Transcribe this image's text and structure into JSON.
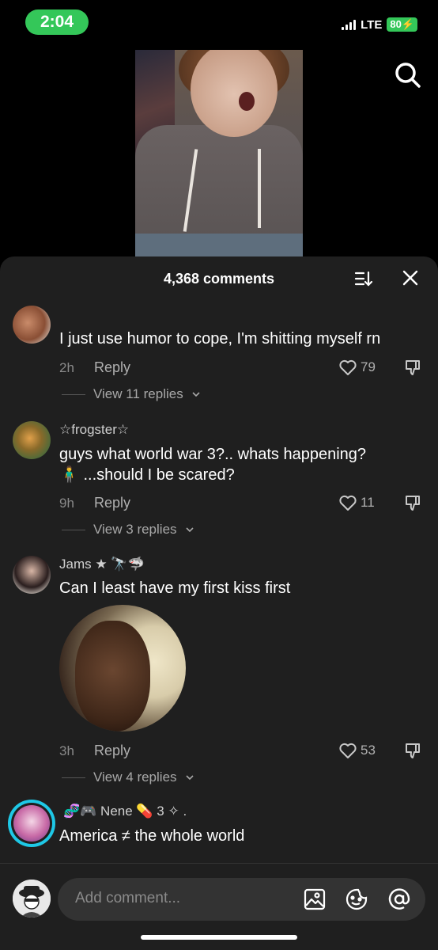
{
  "status": {
    "time": "2:04",
    "network": "LTE",
    "battery": "80"
  },
  "comments_header": {
    "count_label": "4,368 comments"
  },
  "comments": [
    {
      "username": "",
      "text": "I just use humor to cope, I'm shitting myself rn",
      "time": "2h",
      "reply_label": "Reply",
      "likes": "79",
      "view_replies": "View 11 replies"
    },
    {
      "username": "☆frogster☆",
      "text_line1": "guys what world war 3?.. whats happening?",
      "text_line2": "🧍‍♂️ ...should I be scared?",
      "time": "9h",
      "reply_label": "Reply",
      "likes": "11",
      "view_replies": "View 3 replies"
    },
    {
      "username": "Jams ★ 🔭🦈",
      "text": "Can I least have my first kiss first",
      "time": "3h",
      "reply_label": "Reply",
      "likes": "53",
      "view_replies": "View 4 replies"
    },
    {
      "username": "🧬🎮 Nene 💊 3 ✧ .",
      "text": "America ≠ the whole world"
    }
  ],
  "input": {
    "placeholder": "Add comment..."
  },
  "colors": {
    "accent_green": "#34c759",
    "sheet_bg": "#1f1f1f",
    "story_ring": "#1ec8e6"
  }
}
